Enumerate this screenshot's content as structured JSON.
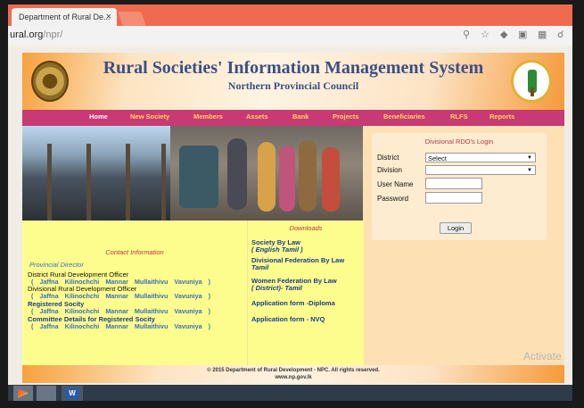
{
  "browser": {
    "tab_title": "Department of Rural De...",
    "tab_close": "×",
    "url_host": "ural.org",
    "url_path": "/npr/"
  },
  "header": {
    "title": "Rural Societies' Information Management System",
    "subtitle": "Northern Provincial Council"
  },
  "nav": [
    "Home",
    "New Society",
    "Members",
    "Assets",
    "Bank",
    "Projects",
    "Beneficiaries",
    "RLFS",
    "Reports"
  ],
  "login": {
    "heading": "Divisional RDO's Login",
    "district_label": "District",
    "district_value": "Select",
    "division_label": "Division",
    "division_value": "",
    "username_label": "User Name",
    "password_label": "Password",
    "button": "Login"
  },
  "contact": {
    "heading": "Contact Information",
    "provincial_director": "Provincial Director",
    "drdo": "District Rural Development Officer",
    "divrdo": "Divisional Rural Development Officer",
    "registered": "Registered Socity",
    "committee": "Committee Details for Registered Socity",
    "districts": [
      "( Jaffna",
      "Kilinochchi",
      "Mannar",
      "Mullaithivu",
      "Vavuniya",
      ")"
    ]
  },
  "downloads": {
    "heading": "Downloads",
    "society_bylaw": "Society By Law",
    "society_bylaw_lang": "( English      Tamil )",
    "div_federation": "Divisional Federation By Law",
    "div_federation_lang": "Tamil",
    "women_federation": "Women Federation By Law",
    "women_federation_lang": "( District)- Tamil",
    "app_diploma": "Application form -Diploma",
    "app_nvq": "Application form - NVQ"
  },
  "footer": {
    "copyright": "© 2015 Department of Rural Development - NPC. All rights reserved.",
    "website": "www.np.gov.lk"
  },
  "watermark": "Activate",
  "taskbar": {
    "word_label": "W"
  },
  "colors": {
    "nav_bg": "#c73a73",
    "nav_text": "#ffd65a",
    "title": "#3b4f86",
    "tab_strip": "#f06a4f"
  }
}
